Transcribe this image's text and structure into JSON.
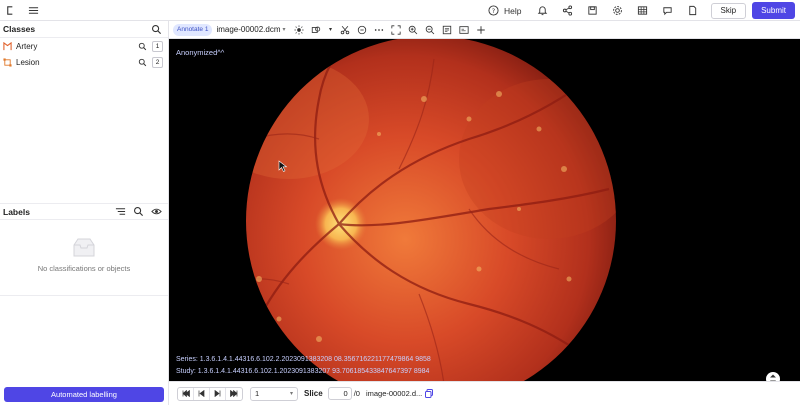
{
  "topbar": {
    "help_label": "Help",
    "skip_label": "Skip",
    "submit_label": "Submit"
  },
  "classes": {
    "title": "Classes",
    "items": [
      {
        "name": "Artery",
        "hotkey": "1",
        "color": "#e0622d"
      },
      {
        "name": "Lesion",
        "hotkey": "2",
        "color": "#e07a2d"
      }
    ]
  },
  "labels": {
    "title": "Labels",
    "empty_text": "No classifications or objects"
  },
  "automated_button": "Automated labelling",
  "viewer": {
    "annotate_tag": "Annotate 1",
    "file_name": "image-00002.dcm",
    "anonymized": "Anonymized^^",
    "series": "Series: 1.3.6.1.4.1.44316.6.102.2.2023091383208 08.356716221177479864 9858",
    "study": "Study: 1.3.6.1.4.1.44316.6.102.1.2023091383207 93.706185433847647397 8984"
  },
  "bottom": {
    "frame_value": "1",
    "slice_label": "Slice",
    "slice_value": "0",
    "slice_total": "/0",
    "file_short": "image-00002.d..."
  },
  "colors": {
    "accent": "#4f46e5"
  }
}
